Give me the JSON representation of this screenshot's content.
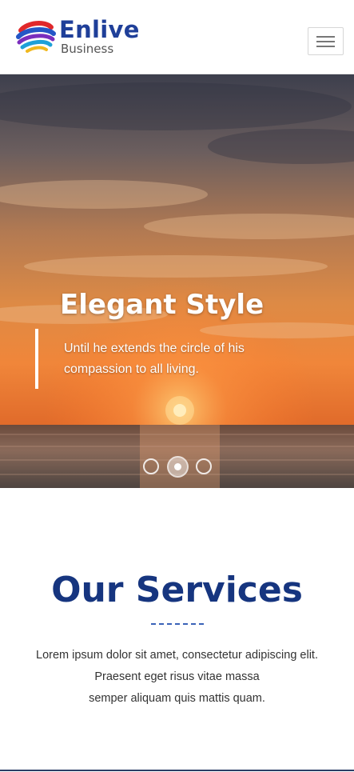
{
  "header": {
    "logo_title": "Enlive",
    "logo_subtitle": "Business",
    "menu_icon": "hamburger-menu-icon"
  },
  "hero": {
    "title": "Elegant Style",
    "text_line1": "Until he extends the circle of his",
    "text_line2": "compassion to all living.",
    "slides": 3,
    "active_slide": 2
  },
  "services": {
    "title": "Our Services",
    "line1": "Lorem ipsum dolor sit amet, consectetur adipiscing elit.",
    "line2": "Praesent eget risus vitae massa",
    "line3": "semper aliquam quis mattis quam."
  },
  "colors": {
    "brand": "#1f3f99",
    "heading": "#16357f",
    "accent_divider": "#3a62b8"
  }
}
